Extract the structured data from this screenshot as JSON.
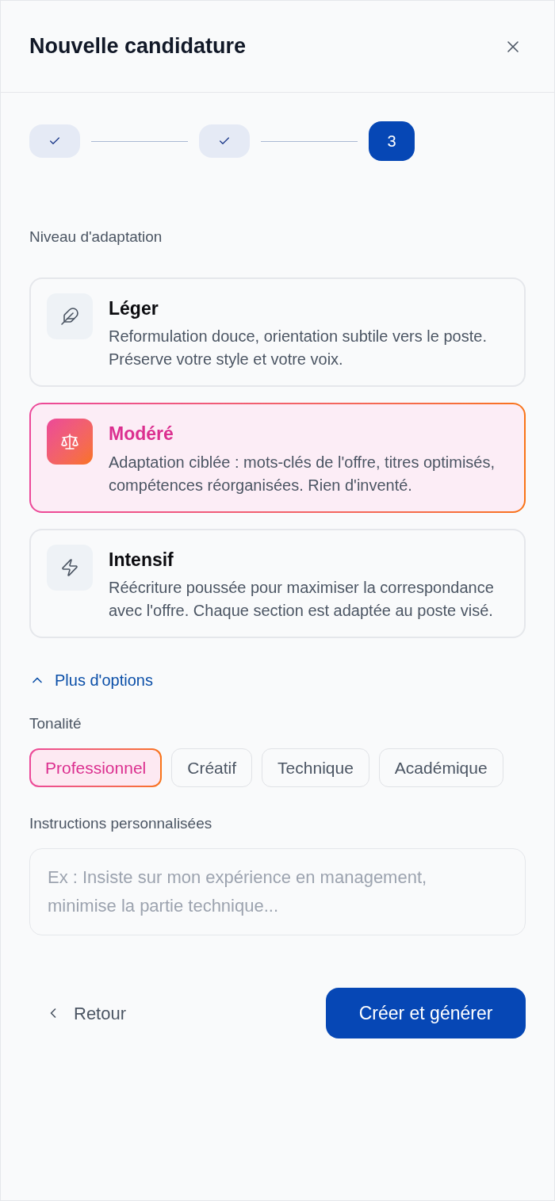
{
  "dialog": {
    "title": "Nouvelle candidature"
  },
  "steps": [
    {
      "done": true
    },
    {
      "done": true
    },
    {
      "done": false,
      "label": "3"
    }
  ],
  "level_section": {
    "label": "Niveau d'adaptation",
    "options": [
      {
        "kind": "feather",
        "title": "Léger",
        "description": "Reformulation douce, orientation subtile vers le poste. Préserve votre style et votre voix.",
        "selected": false
      },
      {
        "kind": "scale",
        "title": "Modéré",
        "description": "Adaptation ciblée : mots-clés de l'offre, titres optimisés, compétences réorganisées. Rien d'inventé.",
        "selected": true
      },
      {
        "kind": "bolt",
        "title": "Intensif",
        "description": "Réécriture poussée pour maximiser la correspondance avec l'offre. Chaque section est adaptée au poste visé.",
        "selected": false
      }
    ]
  },
  "more_options": {
    "label": "Plus d'options",
    "expanded": true
  },
  "tone": {
    "label": "Tonalité",
    "chips": [
      {
        "label": "Professionnel",
        "selected": true
      },
      {
        "label": "Créatif",
        "selected": false
      },
      {
        "label": "Technique",
        "selected": false
      },
      {
        "label": "Académique",
        "selected": false
      }
    ]
  },
  "instructions": {
    "label": "Instructions personnalisées",
    "placeholder": "Ex : Insiste sur mon expérience en management, minimise la partie technique..."
  },
  "footer": {
    "back": "Retour",
    "submit": "Créer et générer"
  }
}
